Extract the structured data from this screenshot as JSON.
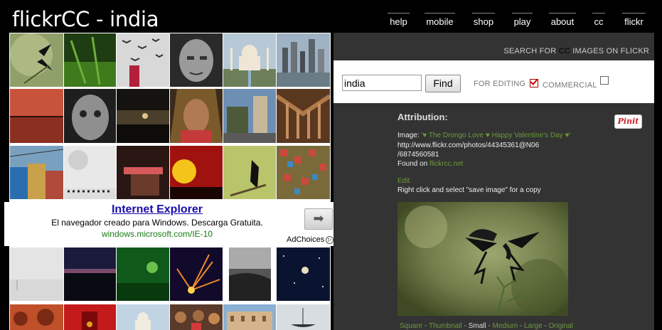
{
  "header": {
    "site_title": "flickrCC - india",
    "nav": [
      "help",
      "mobile",
      "shop",
      "play",
      "about",
      "cc",
      "flickr"
    ]
  },
  "ad": {
    "title": "Internet Explorer",
    "description": "El navegador creado para Windows. Descarga Gratuita.",
    "url": "windows.microsoft.com/IE-10",
    "arrow": "➡",
    "adchoices": "AdChoices"
  },
  "search": {
    "label_prefix": "SEARCH FOR",
    "label_cc": "CC",
    "label_suffix": "IMAGES ON FLICKR",
    "query": "india",
    "find_label": "Find",
    "for_editing_label": "FOR EDITING",
    "for_editing_checked": true,
    "commercial_label": "COMMERCIAL",
    "commercial_checked": false
  },
  "attribution": {
    "heading": "Attribution:",
    "pin_label": "Pinit",
    "image_prefix": "Image:",
    "image_title": "'♥ The Drongo Love ♥ Happy Valentine's Day ♥'",
    "url_line1": "http://www.flickr.com/photos/44345361@N06",
    "url_line2": "/6874560581",
    "found_on_prefix": "Found on",
    "found_on_link": "flickrcc.net",
    "edit_link": "Edit",
    "instruction": "Right click and select \"save image\" for a copy"
  },
  "sizes": {
    "items": [
      "Square",
      "Thumbnail",
      "Small",
      "Medium",
      "Large",
      "Original"
    ],
    "current": "Small",
    "separator": "-"
  },
  "colors": {
    "link_green": "#6c9b3c",
    "panel_bg": "#333333",
    "pin_red": "#c8232c",
    "ad_link": "#1a0dab",
    "ad_url": "#1a7c17"
  }
}
